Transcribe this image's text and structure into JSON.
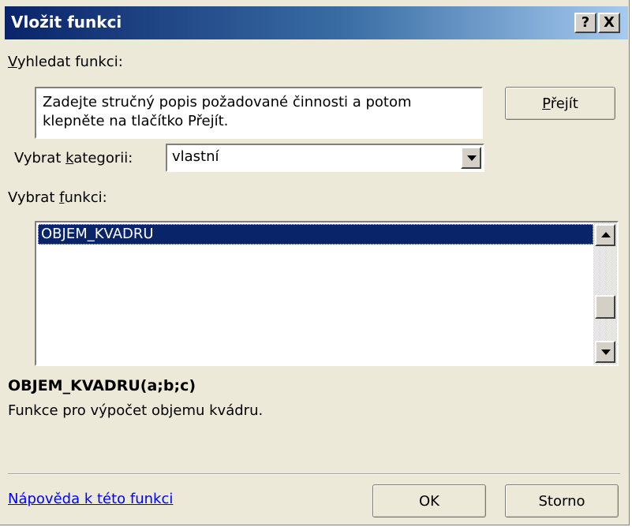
{
  "window": {
    "title": "Vložit funkci",
    "help_label": "?",
    "close_label": "X"
  },
  "search": {
    "label_prefix": "",
    "label_key": "V",
    "label_rest": "yhledat funkci:",
    "value": "Zadejte stručný popis požadované činnosti a potom klepněte na tlačítko Přejít.",
    "go_button_key": "P",
    "go_button_rest": "řejít"
  },
  "category": {
    "label_prefix": "Vybrat ",
    "label_key": "k",
    "label_rest": "ategorii:",
    "selected": "vlastní"
  },
  "functions": {
    "label_prefix": "Vybrat ",
    "label_key": "f",
    "label_rest": "unkci:",
    "items": [
      "OBJEM_KVADRU"
    ],
    "selected_index": 0
  },
  "details": {
    "signature": "OBJEM_KVADRU(a;b;c)",
    "description": "Funkce pro výpočet objemu kvádru."
  },
  "footer": {
    "help_link": "Nápověda k této funkci",
    "ok_label": "OK",
    "cancel_label": "Storno"
  },
  "colors": {
    "title_gradient_start": "#0a246a",
    "dialog_background": "#ece9d8",
    "selection": "#0a246a",
    "link": "#0000ff"
  },
  "icons": [
    "help-icon",
    "close-icon",
    "dropdown-arrow-icon",
    "scroll-up-icon",
    "scroll-down-icon"
  ]
}
